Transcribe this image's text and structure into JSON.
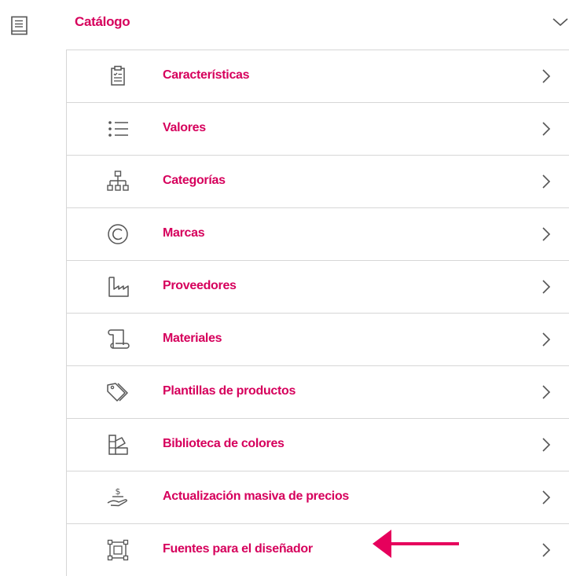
{
  "section": {
    "title": "Catálogo",
    "icon": "catalog-book-icon",
    "expanded": true
  },
  "colors": {
    "accent": "#d6005c",
    "border": "#d6d6d6",
    "icon": "#555555"
  },
  "menu": {
    "items": [
      {
        "label": "Características",
        "icon": "clipboard-checklist-icon"
      },
      {
        "label": "Valores",
        "icon": "list-icon"
      },
      {
        "label": "Categorías",
        "icon": "hierarchy-icon"
      },
      {
        "label": "Marcas",
        "icon": "copyright-icon"
      },
      {
        "label": "Proveedores",
        "icon": "factory-icon"
      },
      {
        "label": "Materiales",
        "icon": "scroll-icon"
      },
      {
        "label": "Plantillas de productos",
        "icon": "tags-icon"
      },
      {
        "label": "Biblioteca de colores",
        "icon": "color-swatches-icon"
      },
      {
        "label": "Actualización masiva de precios",
        "icon": "price-update-icon"
      },
      {
        "label": "Fuentes para el diseñador",
        "icon": "designer-frame-icon"
      }
    ]
  },
  "annotation": {
    "type": "arrow",
    "color": "#e6005c",
    "points_to": "Fuentes para el diseñador"
  }
}
